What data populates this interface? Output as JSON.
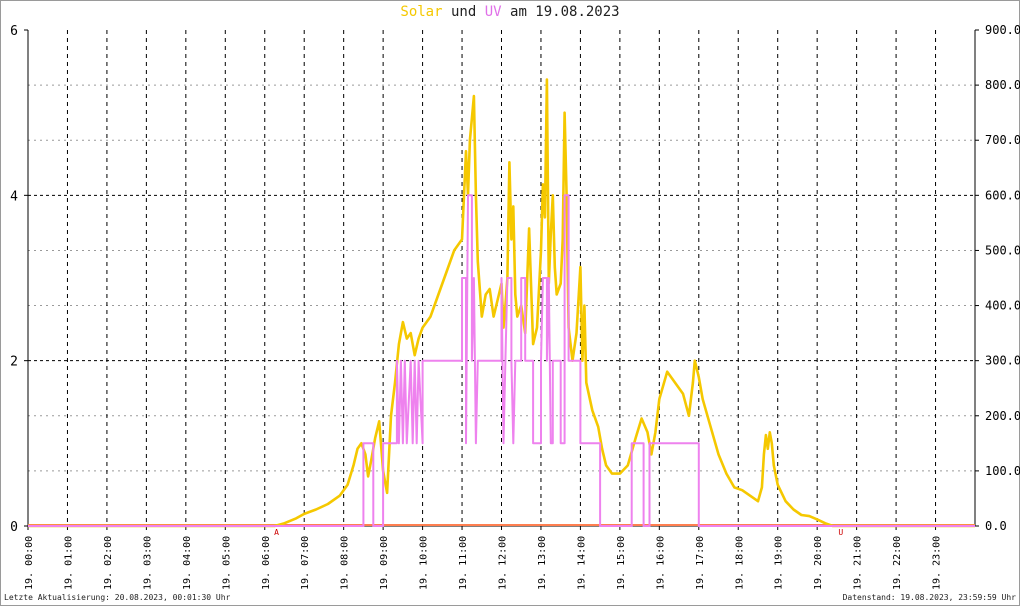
{
  "title": {
    "solar": "Solar",
    "und": "und",
    "uv": "UV",
    "rest": "am 19.08.2023"
  },
  "footer": {
    "left": "Letzte Aktualisierung: 20.08.2023, 00:01:30 Uhr",
    "right": "Datenstand: 19.08.2023, 23:59:59 Uhr"
  },
  "colors": {
    "solar": "#f5c800",
    "uv": "#ee82ee",
    "baseline": "#ff7f50",
    "marker": "#cc0000"
  },
  "chart_data": {
    "type": "line",
    "x_ticks": [
      "19. 00:00",
      "19. 01:00",
      "19. 02:00",
      "19. 03:00",
      "19. 04:00",
      "19. 05:00",
      "19. 06:00",
      "19. 07:00",
      "19. 08:00",
      "19. 09:00",
      "19. 10:00",
      "19. 11:00",
      "19. 12:00",
      "19. 13:00",
      "19. 14:00",
      "19. 15:00",
      "19. 16:00",
      "19. 17:00",
      "19. 18:00",
      "19. 19:00",
      "19. 20:00",
      "19. 21:00",
      "19. 22:00",
      "19. 23:00"
    ],
    "x_range_hours": [
      0,
      24
    ],
    "y_left": {
      "range": [
        0,
        6
      ],
      "ticks": [
        "0",
        "2",
        "4",
        "6"
      ]
    },
    "y_right": {
      "range": [
        0,
        900
      ],
      "ticks": [
        "0.0",
        "100.0",
        "200.0",
        "300.0",
        "400.0",
        "500.0",
        "600.0",
        "700.0",
        "800.0",
        "900.0"
      ]
    },
    "grid": true,
    "markers": [
      {
        "label": "A",
        "hour": 6.3
      },
      {
        "label": "U",
        "hour": 20.6
      }
    ],
    "series": [
      {
        "name": "Solar",
        "axis": "right",
        "points": [
          [
            0,
            0
          ],
          [
            6.25,
            0
          ],
          [
            6.5,
            5
          ],
          [
            6.8,
            14
          ],
          [
            7.0,
            22
          ],
          [
            7.3,
            30
          ],
          [
            7.6,
            40
          ],
          [
            7.9,
            55
          ],
          [
            8.1,
            75
          ],
          [
            8.25,
            110
          ],
          [
            8.35,
            140
          ],
          [
            8.45,
            150
          ],
          [
            8.55,
            130
          ],
          [
            8.62,
            90
          ],
          [
            8.7,
            120
          ],
          [
            8.8,
            160
          ],
          [
            8.9,
            190
          ],
          [
            9.0,
            100
          ],
          [
            9.1,
            60
          ],
          [
            9.2,
            200
          ],
          [
            9.3,
            260
          ],
          [
            9.4,
            330
          ],
          [
            9.5,
            370
          ],
          [
            9.6,
            340
          ],
          [
            9.7,
            350
          ],
          [
            9.8,
            310
          ],
          [
            9.9,
            340
          ],
          [
            10.0,
            360
          ],
          [
            10.2,
            380
          ],
          [
            10.4,
            420
          ],
          [
            10.6,
            460
          ],
          [
            10.8,
            500
          ],
          [
            11.0,
            520
          ],
          [
            11.05,
            600
          ],
          [
            11.1,
            680
          ],
          [
            11.15,
            600
          ],
          [
            11.2,
            700
          ],
          [
            11.25,
            740
          ],
          [
            11.3,
            780
          ],
          [
            11.35,
            600
          ],
          [
            11.4,
            480
          ],
          [
            11.5,
            380
          ],
          [
            11.6,
            420
          ],
          [
            11.7,
            430
          ],
          [
            11.8,
            380
          ],
          [
            11.9,
            410
          ],
          [
            12.0,
            440
          ],
          [
            12.05,
            360
          ],
          [
            12.1,
            400
          ],
          [
            12.15,
            450
          ],
          [
            12.2,
            660
          ],
          [
            12.25,
            520
          ],
          [
            12.3,
            580
          ],
          [
            12.35,
            420
          ],
          [
            12.4,
            380
          ],
          [
            12.5,
            400
          ],
          [
            12.6,
            350
          ],
          [
            12.7,
            540
          ],
          [
            12.8,
            330
          ],
          [
            12.9,
            360
          ],
          [
            13.0,
            500
          ],
          [
            13.05,
            620
          ],
          [
            13.1,
            560
          ],
          [
            13.15,
            810
          ],
          [
            13.2,
            440
          ],
          [
            13.25,
            530
          ],
          [
            13.3,
            600
          ],
          [
            13.35,
            470
          ],
          [
            13.4,
            420
          ],
          [
            13.5,
            440
          ],
          [
            13.55,
            520
          ],
          [
            13.6,
            750
          ],
          [
            13.65,
            600
          ],
          [
            13.7,
            360
          ],
          [
            13.8,
            300
          ],
          [
            13.9,
            350
          ],
          [
            14.0,
            470
          ],
          [
            14.05,
            300
          ],
          [
            14.1,
            400
          ],
          [
            14.15,
            260
          ],
          [
            14.3,
            210
          ],
          [
            14.45,
            180
          ],
          [
            14.55,
            140
          ],
          [
            14.65,
            110
          ],
          [
            14.8,
            95
          ],
          [
            15.0,
            95
          ],
          [
            15.2,
            110
          ],
          [
            15.4,
            160
          ],
          [
            15.55,
            195
          ],
          [
            15.7,
            170
          ],
          [
            15.8,
            130
          ],
          [
            15.9,
            170
          ],
          [
            16.0,
            230
          ],
          [
            16.2,
            280
          ],
          [
            16.4,
            260
          ],
          [
            16.6,
            240
          ],
          [
            16.75,
            200
          ],
          [
            16.85,
            260
          ],
          [
            16.9,
            300
          ],
          [
            17.0,
            270
          ],
          [
            17.1,
            230
          ],
          [
            17.3,
            180
          ],
          [
            17.5,
            130
          ],
          [
            17.7,
            95
          ],
          [
            17.9,
            70
          ],
          [
            18.1,
            65
          ],
          [
            18.3,
            55
          ],
          [
            18.5,
            45
          ],
          [
            18.6,
            70
          ],
          [
            18.65,
            130
          ],
          [
            18.7,
            165
          ],
          [
            18.75,
            140
          ],
          [
            18.8,
            170
          ],
          [
            18.85,
            150
          ],
          [
            18.9,
            110
          ],
          [
            19.0,
            75
          ],
          [
            19.2,
            45
          ],
          [
            19.4,
            30
          ],
          [
            19.6,
            20
          ],
          [
            19.8,
            18
          ],
          [
            20.0,
            12
          ],
          [
            20.2,
            5
          ],
          [
            20.4,
            0
          ],
          [
            24,
            0
          ]
        ]
      },
      {
        "name": "UV",
        "axis": "left",
        "points": [
          [
            0,
            0
          ],
          [
            8.5,
            0
          ],
          [
            8.5,
            1
          ],
          [
            8.75,
            1
          ],
          [
            8.75,
            0
          ],
          [
            9.0,
            0
          ],
          [
            9.0,
            1
          ],
          [
            9.35,
            1
          ],
          [
            9.35,
            2
          ],
          [
            9.4,
            1
          ],
          [
            9.45,
            2
          ],
          [
            9.5,
            1
          ],
          [
            9.55,
            2
          ],
          [
            9.6,
            1
          ],
          [
            9.7,
            2
          ],
          [
            9.75,
            1
          ],
          [
            9.8,
            2
          ],
          [
            9.85,
            1
          ],
          [
            9.9,
            2
          ],
          [
            10.0,
            1
          ],
          [
            10.0,
            2
          ],
          [
            11.0,
            2
          ],
          [
            11.0,
            3
          ],
          [
            11.1,
            3
          ],
          [
            11.1,
            1
          ],
          [
            11.15,
            4
          ],
          [
            11.25,
            4
          ],
          [
            11.25,
            2
          ],
          [
            11.3,
            3
          ],
          [
            11.35,
            1
          ],
          [
            11.4,
            2
          ],
          [
            12.0,
            2
          ],
          [
            12.0,
            3
          ],
          [
            12.05,
            1
          ],
          [
            12.1,
            2
          ],
          [
            12.15,
            3
          ],
          [
            12.25,
            3
          ],
          [
            12.25,
            2
          ],
          [
            12.3,
            1
          ],
          [
            12.35,
            2
          ],
          [
            12.5,
            2
          ],
          [
            12.5,
            3
          ],
          [
            12.6,
            3
          ],
          [
            12.6,
            2
          ],
          [
            12.8,
            2
          ],
          [
            12.8,
            1
          ],
          [
            13.0,
            1
          ],
          [
            13.0,
            2
          ],
          [
            13.05,
            3
          ],
          [
            13.15,
            3
          ],
          [
            13.15,
            2
          ],
          [
            13.2,
            3
          ],
          [
            13.25,
            1
          ],
          [
            13.3,
            1
          ],
          [
            13.3,
            2
          ],
          [
            13.5,
            2
          ],
          [
            13.5,
            1
          ],
          [
            13.6,
            1
          ],
          [
            13.6,
            4
          ],
          [
            13.7,
            4
          ],
          [
            13.7,
            2
          ],
          [
            14.0,
            2
          ],
          [
            14.0,
            1
          ],
          [
            14.5,
            1
          ],
          [
            14.5,
            0
          ],
          [
            15.0,
            0
          ],
          [
            15.3,
            0
          ],
          [
            15.3,
            1
          ],
          [
            15.6,
            1
          ],
          [
            15.6,
            0
          ],
          [
            15.75,
            0
          ],
          [
            15.75,
            1
          ],
          [
            17.0,
            1
          ],
          [
            17.0,
            0
          ],
          [
            24,
            0
          ]
        ]
      }
    ]
  }
}
